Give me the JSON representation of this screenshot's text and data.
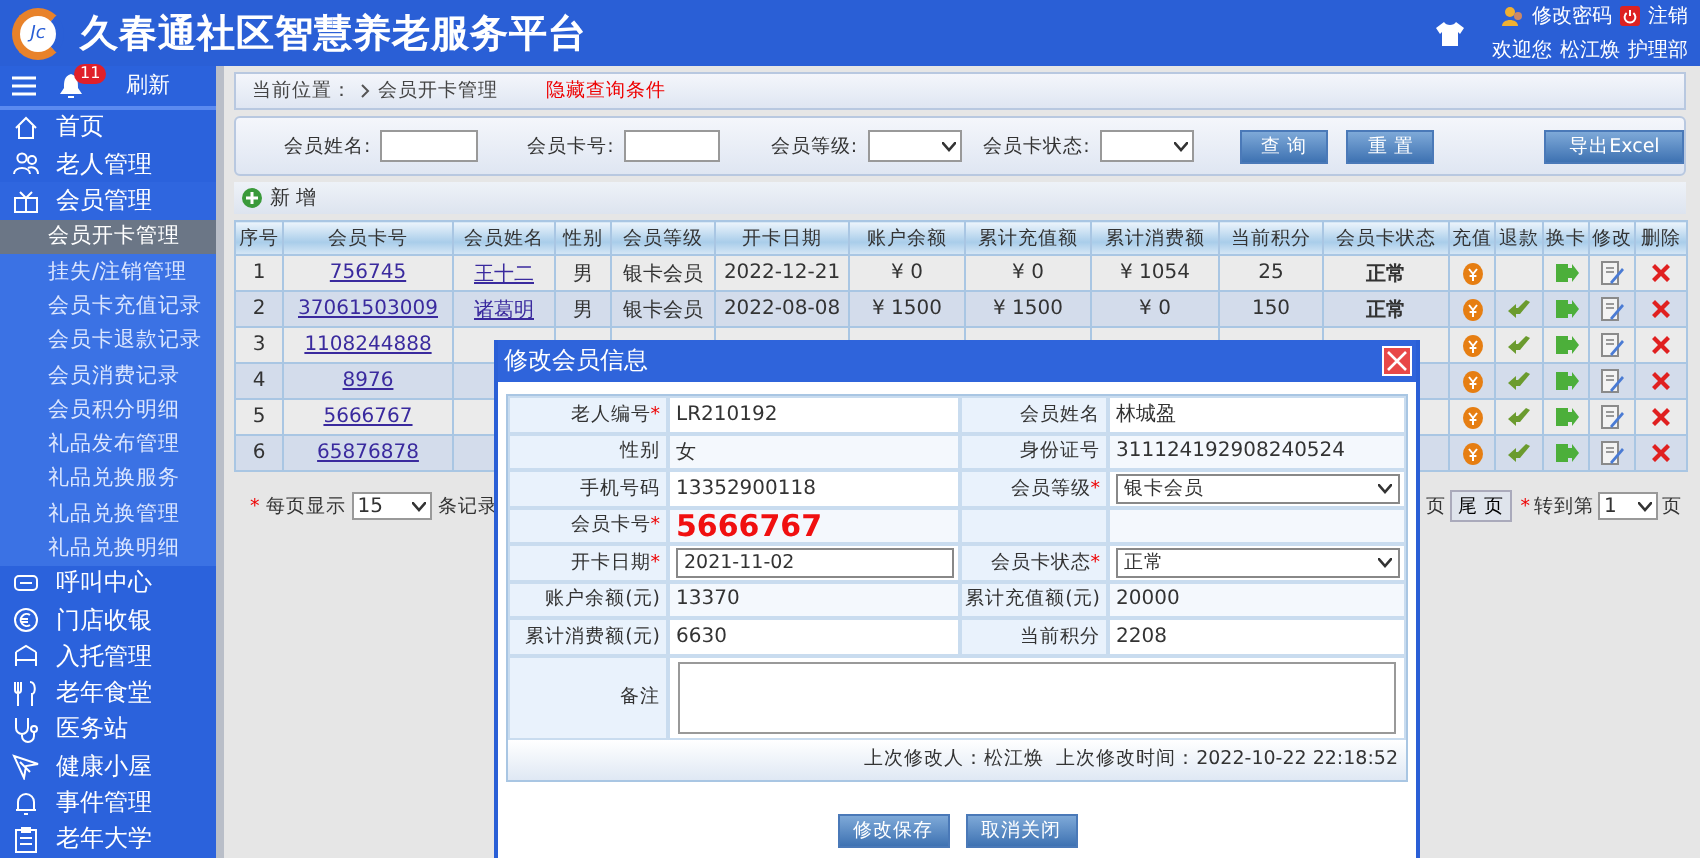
{
  "header": {
    "logo_text": "Jc",
    "title": "久春通社区智慧养老服务平台",
    "links": [
      "修改密码",
      "注销"
    ],
    "welcome": "欢迎您",
    "user": "松江焕",
    "department": "护理部"
  },
  "sidebar": {
    "badge": "11",
    "refresh": "刷新",
    "items": [
      {
        "label": "首页",
        "expanded": false
      },
      {
        "label": "老人管理",
        "expanded": false
      },
      {
        "label": "会员管理",
        "expanded": true,
        "children": [
          {
            "label": "会员开卡管理",
            "selected": true
          },
          {
            "label": "挂失/注销管理",
            "selected": false
          },
          {
            "label": "会员卡充值记录",
            "selected": false
          },
          {
            "label": "会员卡退款记录",
            "selected": false
          },
          {
            "label": "会员消费记录",
            "selected": false
          },
          {
            "label": "会员积分明细",
            "selected": false
          },
          {
            "label": "礼品发布管理",
            "selected": false
          },
          {
            "label": "礼品兑换服务",
            "selected": false
          },
          {
            "label": "礼品兑换管理",
            "selected": false
          },
          {
            "label": "礼品兑换明细",
            "selected": false
          }
        ]
      },
      {
        "label": "呼叫中心",
        "expanded": false
      },
      {
        "label": "门店收银",
        "expanded": false
      },
      {
        "label": "入托管理",
        "expanded": false
      },
      {
        "label": "老年食堂",
        "expanded": false
      },
      {
        "label": "医务站",
        "expanded": false
      },
      {
        "label": "健康小屋",
        "expanded": false
      },
      {
        "label": "事件管理",
        "expanded": false
      },
      {
        "label": "老年大学",
        "expanded": false
      }
    ]
  },
  "breadcrumb": {
    "label": "当前位置：",
    "path": "会员开卡管理",
    "toggle": "隐藏查询条件"
  },
  "search": {
    "fields": [
      {
        "label": "会员姓名:",
        "kind": "text"
      },
      {
        "label": "会员卡号:",
        "kind": "text"
      },
      {
        "label": "会员等级:",
        "kind": "select"
      },
      {
        "label": "会员卡状态:",
        "kind": "select"
      }
    ],
    "buttons": [
      "查 询",
      "重 置"
    ],
    "export": "导出Excel"
  },
  "add": "新 增",
  "table": {
    "columns": [
      "序号",
      "会员卡号",
      "会员姓名",
      "性别",
      "会员等级",
      "开卡日期",
      "账户余额",
      "累计充值额",
      "累计消费额",
      "当前积分",
      "会员卡状态",
      "充值",
      "退款",
      "换卡",
      "修改",
      "删除"
    ],
    "rows": [
      {
        "no": "1",
        "card": "756745",
        "name": "王十二",
        "gender": "男",
        "level": "银卡会员",
        "date": "2022-12-21",
        "balance": "¥ 0",
        "recharged": "¥ 0",
        "spent": "¥ 1054",
        "points": "25",
        "status": "正常",
        "refund": false
      },
      {
        "no": "2",
        "card": "37061503009",
        "name": "诸葛明",
        "gender": "男",
        "level": "银卡会员",
        "date": "2022-08-08",
        "balance": "¥ 1500",
        "recharged": "¥ 1500",
        "spent": "¥ 0",
        "points": "150",
        "status": "正常",
        "refund": true
      },
      {
        "no": "3",
        "card": "1108244888",
        "refund": true
      },
      {
        "no": "4",
        "card": "8976",
        "refund": true
      },
      {
        "no": "5",
        "card": "5666767",
        "refund": true
      },
      {
        "no": "6",
        "card": "65876878",
        "refund": true
      }
    ]
  },
  "pagination": {
    "mark": "*",
    "per_page_label": "每页显示",
    "per_page": "15",
    "per_page_suffix": "条记录",
    "prev": "页",
    "last": "尾 页",
    "goto_mark": "*",
    "goto": "转到第",
    "page": "1",
    "page_suffix": "页"
  },
  "modal": {
    "title": "修改会员信息",
    "fields": [
      {
        "label": "老人编号",
        "required": true,
        "kind": "text",
        "value": "LR210192"
      },
      {
        "label": "会员姓名",
        "required": false,
        "kind": "text",
        "value": "林城盈"
      },
      {
        "label": "性别",
        "required": false,
        "kind": "text",
        "value": "女"
      },
      {
        "label": "身份证号",
        "required": false,
        "kind": "text",
        "value": "311124192908240524"
      },
      {
        "label": "手机号码",
        "required": false,
        "kind": "text",
        "value": "13352900118"
      },
      {
        "label": "会员等级",
        "required": true,
        "kind": "select",
        "value": "银卡会员"
      },
      {
        "label": "会员卡号",
        "required": true,
        "kind": "highlight",
        "value": "5666767"
      },
      {
        "kind": "empty"
      },
      {
        "label": "开卡日期",
        "required": true,
        "kind": "input",
        "value": "2021-11-02"
      },
      {
        "label": "会员卡状态",
        "required": true,
        "kind": "select",
        "value": "正常"
      },
      {
        "label": "账户余额(元)",
        "required": false,
        "kind": "text",
        "value": "13370"
      },
      {
        "label": "累计充值额(元)",
        "required": false,
        "kind": "text",
        "value": "20000"
      },
      {
        "label": "累计消费额(元)",
        "required": false,
        "kind": "text",
        "value": "6630"
      },
      {
        "label": "当前积分",
        "required": false,
        "kind": "text",
        "value": "2208"
      },
      {
        "label": "备注",
        "required": false,
        "kind": "textarea"
      }
    ],
    "required_mark": "*",
    "footer": {
      "editor_label": "上次修改人：",
      "editor": "松江焕",
      "time_label": "上次修改时间：",
      "time": "2022-10-22 22:18:52"
    },
    "buttons": [
      "修改保存",
      "取消关闭"
    ]
  }
}
